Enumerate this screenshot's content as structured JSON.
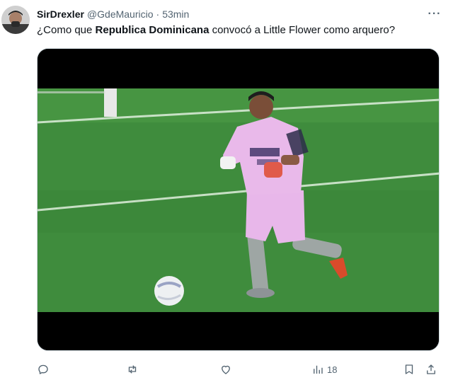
{
  "tweet": {
    "display_name": "SirDrexler",
    "handle": "@GdeMauricio",
    "separator": "·",
    "time": "53min",
    "more_label": "···",
    "text_parts": {
      "before": "¿Como que ",
      "bold": "Republica Dominicana",
      "after": " convocó a Little Flower como arquero?"
    }
  },
  "actions": {
    "reply_icon": "reply-icon",
    "retweet_icon": "retweet-icon",
    "like_icon": "heart-icon",
    "views_icon": "views-icon",
    "views_count": "18",
    "bookmark_icon": "bookmark-icon",
    "share_icon": "share-icon"
  },
  "colors": {
    "text": "#0f1419",
    "muted": "#536471",
    "pitch": "#3d8a3c",
    "kit": "#e7b6e8"
  }
}
